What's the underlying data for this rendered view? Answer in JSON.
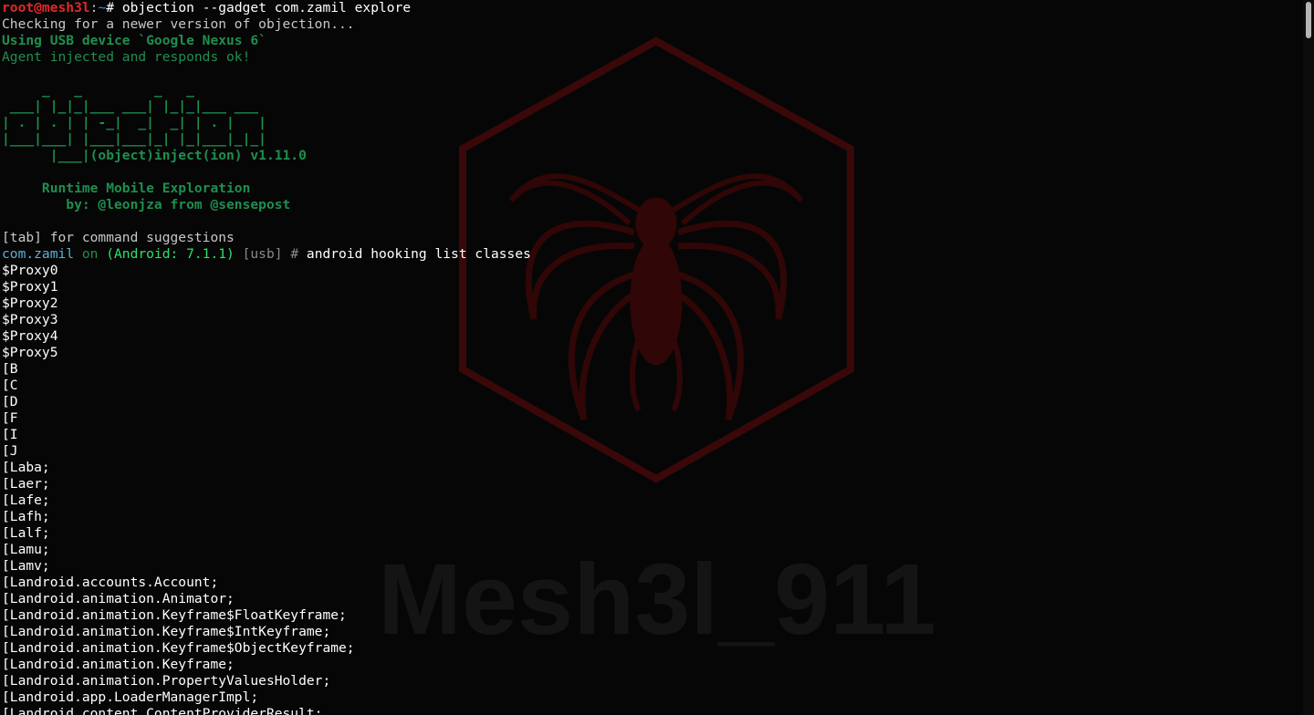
{
  "wallpaper": {
    "watermark_text": "Mesh3l_911",
    "emblem": "spider-hexagon-logo",
    "accent_color": "#5a0a0a"
  },
  "prompt": {
    "user_host": "root@mesh3l",
    "sep": ":",
    "path": "~",
    "symbol": "# ",
    "command": "objection --gadget com.zamil explore"
  },
  "status": {
    "checking": "Checking for a newer version of objection...",
    "device": "Using USB device `Google Nexus 6`",
    "agent": "Agent injected and responds ok!"
  },
  "banner": {
    "art": [
      "     _   _         _   _",
      " ___| |_|_|___ ___| |_|_|___ ___",
      "| . | . | | -_|  _|  _| | . |   |",
      "|___|___| |___|___|_| |_|___|_|_|",
      "      |___|(object)inject(ion) v1.11.0"
    ],
    "title": "     Runtime Mobile Exploration",
    "byline": "        by: @leonjza from @sensepost"
  },
  "hint": "[tab] for command suggestions",
  "repl": {
    "app": "com.zamil",
    "on": " on ",
    "platform": "(Android: 7.1.1)",
    "transport": " [usb] # ",
    "command": "android hooking list classes"
  },
  "output": [
    "$Proxy0",
    "$Proxy1",
    "$Proxy2",
    "$Proxy3",
    "$Proxy4",
    "$Proxy5",
    "[B",
    "[C",
    "[D",
    "[F",
    "[I",
    "[J",
    "[Laba;",
    "[Laer;",
    "[Lafe;",
    "[Lafh;",
    "[Lalf;",
    "[Lamu;",
    "[Lamv;",
    "[Landroid.accounts.Account;",
    "[Landroid.animation.Animator;",
    "[Landroid.animation.Keyframe$FloatKeyframe;",
    "[Landroid.animation.Keyframe$IntKeyframe;",
    "[Landroid.animation.Keyframe$ObjectKeyframe;",
    "[Landroid.animation.Keyframe;",
    "[Landroid.animation.PropertyValuesHolder;",
    "[Landroid.app.LoaderManagerImpl;",
    "[Landroid.content.ContentProviderResult;"
  ]
}
